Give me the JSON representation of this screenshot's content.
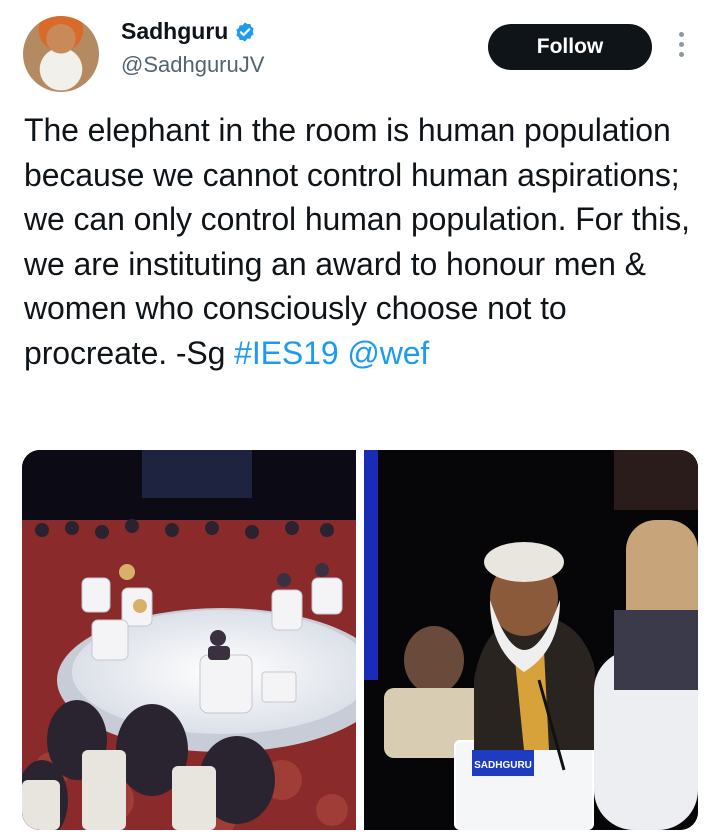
{
  "tweet": {
    "author": {
      "display_name": "Sadhguru",
      "handle": "@SadhguruJV",
      "verified": true
    },
    "follow_label": "Follow",
    "text_plain": "The elephant in the room is human population because we cannot control human aspirations; we can only control human population. For this, we are instituting an award to honour men & women who consciously choose not to procreate. -Sg ",
    "hashtag": "#IES19",
    "mention": "@wef",
    "media": [
      {
        "icon": "photo",
        "description": "panel discussion stage"
      },
      {
        "icon": "photo",
        "description": "speaker on stage",
        "placard": "SADHGURU"
      }
    ]
  },
  "colors": {
    "accent": "#1d9bf0",
    "follow_bg": "#0f1419",
    "text": "#0f1419",
    "secondary": "#536471",
    "verified": "#1d9bf0"
  }
}
